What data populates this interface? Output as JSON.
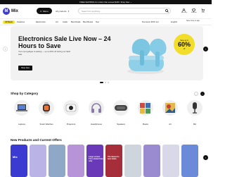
{
  "topbar": {
    "text": "FREE SHIPPING for orders that exceed $200. Shop Now →"
  },
  "brand": {
    "name": "Mix",
    "mark": "M",
    "color": "#3b3bd1"
  },
  "header": {
    "menu_label": "Menu",
    "category_select": "All products",
    "search_placeholder": "Search for anything...",
    "account_label": "Account",
    "wishlist_label": "Wishlist",
    "cart_label": "Cart"
  },
  "nav": {
    "chip": "All Deals",
    "items": [
      "Features",
      "Electronics",
      "Art",
      "Audio",
      "Best Deals",
      "Best Books",
      "Non"
    ],
    "region": "Romania (RON lei)",
    "language": "English",
    "help": "Save more on app"
  },
  "hero": {
    "title": "Electronics Sale Live Now – 24 Hours to Save",
    "subtitle": "Your next gadget is waiting — up to 60% off during our flash sale.",
    "button": "Shop Now",
    "badge_small": "Save up to",
    "badge_big": "60%",
    "badge_small2": "off"
  },
  "categories_section": {
    "title": "Shop by Category"
  },
  "categories": [
    {
      "label": "Laptops",
      "icon": "laptop-icon"
    },
    {
      "label": "Smart Watches",
      "icon": "watch-icon"
    },
    {
      "label": "Projectors",
      "icon": "projector-icon"
    },
    {
      "label": "Headphones",
      "icon": "headphones-icon"
    },
    {
      "label": "Speakers",
      "icon": "speaker-icon"
    },
    {
      "label": "Books",
      "icon": "books-icon"
    },
    {
      "label": "Art",
      "icon": "art-icon"
    },
    {
      "label": "Mic",
      "icon": "mic-icon"
    }
  ],
  "offers_section": {
    "title": "New Products and Current Offers"
  },
  "offer_cards": [
    {
      "text": "Mix",
      "color": "#3b3bd1"
    },
    {
      "text": "",
      "color": "#b9b3e6"
    },
    {
      "text": "",
      "color": "#8fa8c8"
    },
    {
      "text": "",
      "color": "#b794d8"
    },
    {
      "text": "Large screen TVs Limited time only",
      "color": "#6a39b8"
    },
    {
      "text": "The Season's best deals",
      "color": "#a52e3a"
    },
    {
      "text": "",
      "color": "#cfd5dc"
    },
    {
      "text": "",
      "color": "#9a8ad0"
    },
    {
      "text": "",
      "color": "#d8d8e8"
    },
    {
      "text": "",
      "color": "#6b8ad8"
    }
  ]
}
